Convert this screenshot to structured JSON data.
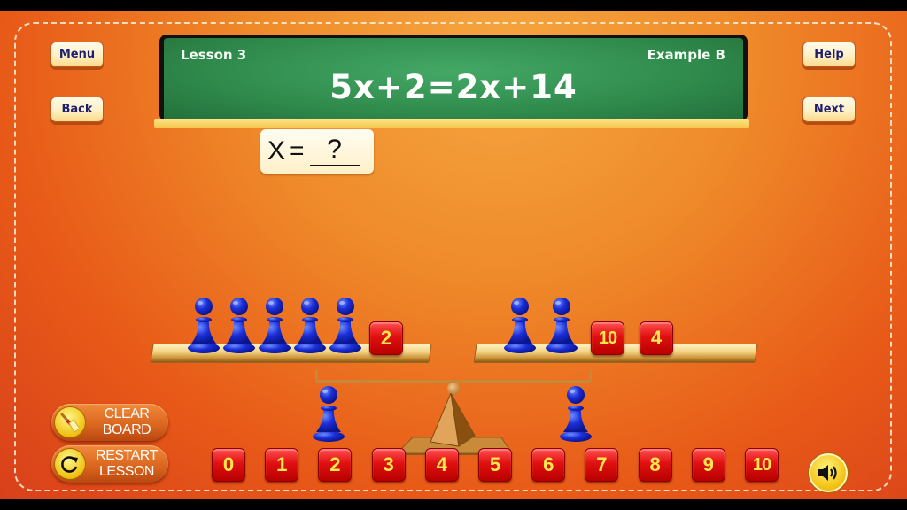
{
  "nav": {
    "menu_label": "Menu",
    "back_label": "Back",
    "help_label": "Help",
    "next_label": "Next"
  },
  "chalkboard": {
    "lesson": "Lesson 3",
    "example": "Example B",
    "equation": "5x+2=2x+14"
  },
  "answer": {
    "variable": "X",
    "equals": "=",
    "value": "?"
  },
  "scale": {
    "left_pan": {
      "pawns": 5,
      "tiles": [
        "2"
      ]
    },
    "right_pan": {
      "pawns": 2,
      "tiles": [
        "10",
        "4"
      ]
    }
  },
  "tray_pawns": 2,
  "number_tiles": [
    "0",
    "1",
    "2",
    "3",
    "4",
    "5",
    "6",
    "7",
    "8",
    "9",
    "10"
  ],
  "controls": {
    "clear_board": {
      "line1": "CLEAR",
      "line2": "BOARD",
      "icon": "broom-icon"
    },
    "restart_lesson": {
      "line1": "RESTART",
      "line2": "LESSON",
      "icon": "restart-icon"
    },
    "sound": {
      "icon": "speaker-icon"
    }
  },
  "colors": {
    "background": "#ef8a2a",
    "chalkboard": "#2f8a4c",
    "pawn": "#1a2fd8",
    "tile": "#e01010",
    "tile_text": "#ffe84a",
    "nav_text": "#1c1e6e"
  }
}
